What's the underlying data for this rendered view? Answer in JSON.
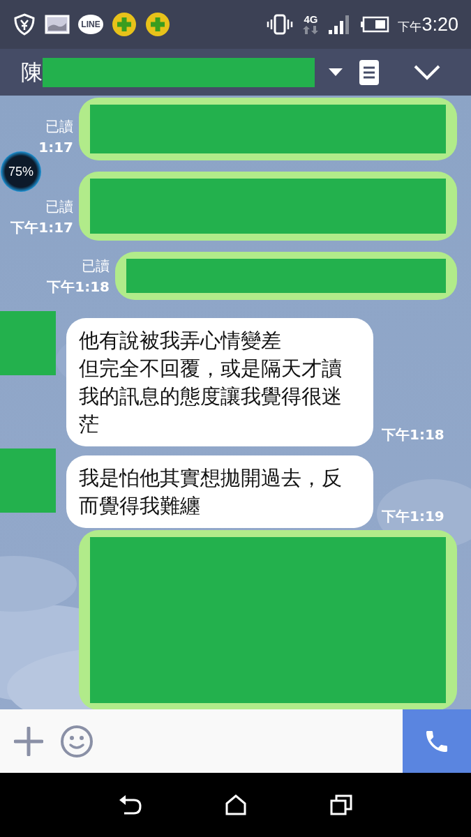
{
  "status_bar": {
    "line_icon_label": "LINE",
    "network": "4G",
    "time_period": "下午",
    "time": "3:20"
  },
  "header": {
    "title": "陳"
  },
  "overlay_badge": {
    "label": "75%"
  },
  "messages": [
    {
      "kind": "redacted",
      "outgoing": true,
      "read_label": "已讀",
      "time": "1:17"
    },
    {
      "kind": "redacted",
      "outgoing": true,
      "read_label": "已讀",
      "time": "下午1:17"
    },
    {
      "kind": "redacted",
      "outgoing": true,
      "read_label": "已讀",
      "time": "下午1:18"
    },
    {
      "kind": "text",
      "outgoing": false,
      "lines": [
        "他有說被我弄心情變差",
        "但完全不回覆，或是隔天才讀我的訊息的態度讓我覺得很迷茫"
      ],
      "time": "下午1:18"
    },
    {
      "kind": "text",
      "outgoing": false,
      "lines": [
        "我是怕他其實想拋開過去，反而覺得我難纏"
      ],
      "time": "下午1:19"
    },
    {
      "kind": "redacted",
      "outgoing": true
    }
  ]
}
